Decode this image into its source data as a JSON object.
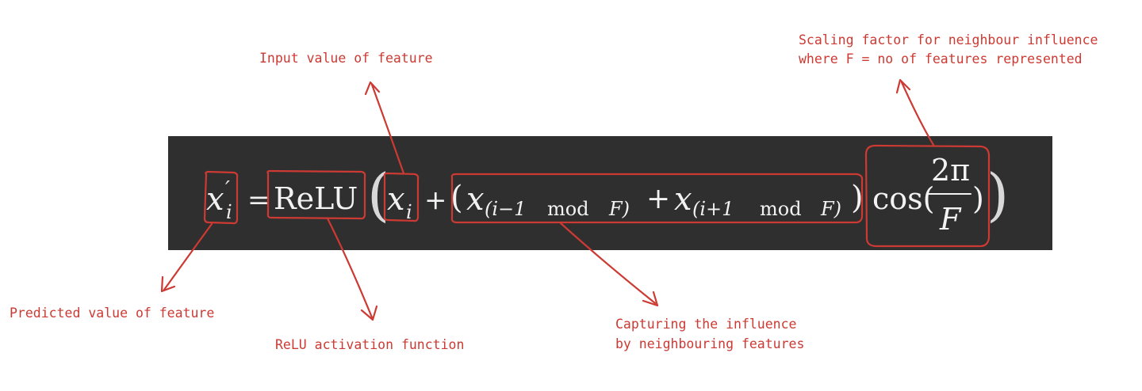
{
  "formula": {
    "lhs_var": "x",
    "lhs_prime": "′",
    "lhs_sub": "i",
    "equals": "=",
    "relu": "ReLU",
    "open_big": "(",
    "xi_var": "x",
    "xi_sub": "i",
    "plus1": "+",
    "open_paren": "(",
    "x_prev_var": "x",
    "x_prev_sub": "(i−1",
    "mod1": "mod",
    "F1": "F)",
    "plus2": "+",
    "x_next_var": "x",
    "x_next_sub": "(i+1",
    "mod2": "mod",
    "F2": "F)",
    "close_paren": ")",
    "cos": "cos(",
    "frac_num": "2π",
    "frac_den": "F",
    "cos_close": ")",
    "close_big": ")"
  },
  "annotations": {
    "input_value": "Input value of feature",
    "scaling_line1": "Scaling factor for neighbour influence",
    "scaling_line2": "where F = no of features represented",
    "predicted_value": "Predicted value of feature",
    "relu_activation": "ReLU activation function",
    "neighbour_line1": "Capturing the influence",
    "neighbour_line2": "by neighbouring features"
  },
  "colors": {
    "annotation": "#cc3a33",
    "panel": "#2f2f2f",
    "formula_text": "#f2f2f2"
  }
}
